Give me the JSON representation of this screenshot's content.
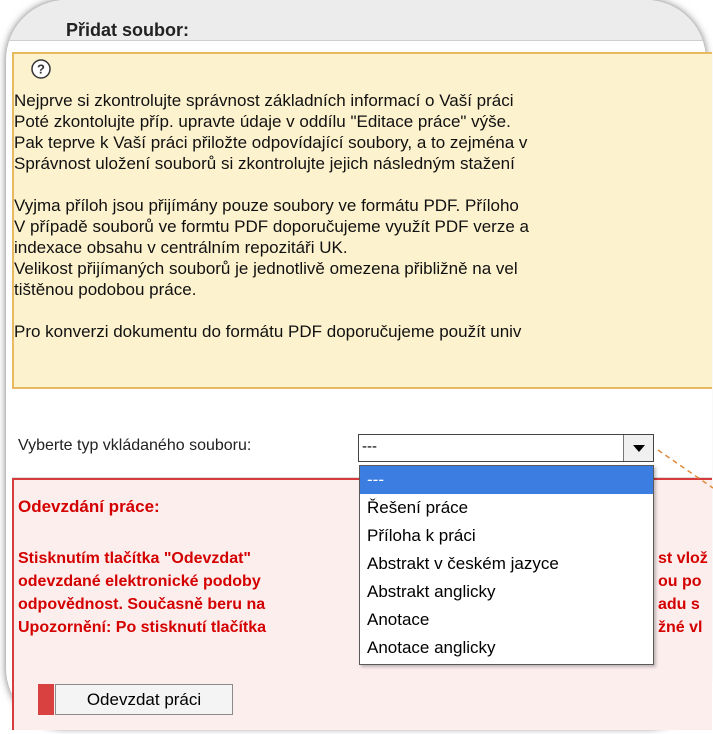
{
  "section_title": "Přidat soubor:",
  "help_icon": "question-mark-icon",
  "info": {
    "lines": [
      "Nejprve si zkontrolujte správnost základních informací o Vaší práci",
      "Poté zkontolujte příp. upravte údaje v oddílu \"Editace práce\" výše.",
      "Pak teprve k Vaší práci přiložte odpovídající soubory, a to zejména v",
      "Správnost uložení souborů si zkontrolujte jejich následným stažení",
      "Vyjma příloh jsou přijímány pouze soubory ve formátu PDF. Přílohο",
      "V případě souborů ve formtu PDF doporučujeme využít PDF verze a",
      "indexace obsahu v centrálním repozitáři UK.",
      "Velikost přijímaných souborů je jednotlivě omezena přibližně na vel",
      "tištěnou podobou práce.",
      "Pro konverzi dokumentu do formátu PDF doporučujeme použít univ"
    ]
  },
  "file_type": {
    "label": "Vyberte typ vkládaného souboru:",
    "selected_value": "---",
    "options": [
      "---",
      "Řešení práce",
      "Příloha k práci",
      "Abstrakt v českém jazyce",
      "Abstrakt anglicky",
      "Anotace",
      "Anotace anglicky"
    ]
  },
  "submission": {
    "title": "Odevzdání práce:",
    "lines": [
      "Stisknutím tlačítka \"Odevzdat\"",
      "odevzdané elektronické podoby",
      "odpovědnost. Současně beru na",
      "Upozornění: Po stisknutí tlačítka"
    ],
    "lines_right": [
      "st vlož",
      "ou po",
      "adu s",
      "žné vl"
    ],
    "button_label": "Odevzdat práci"
  },
  "colors": {
    "info_bg": "#fdf2ce",
    "warn_text": "#d40000",
    "selected_option": "#3b7de0"
  }
}
